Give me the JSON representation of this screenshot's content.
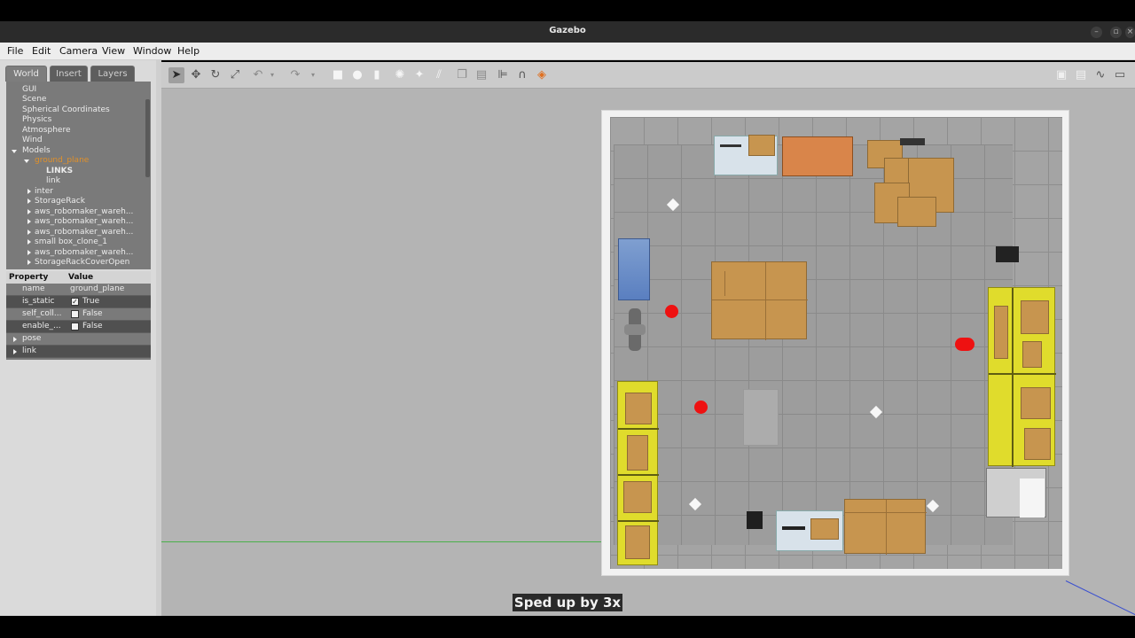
{
  "window": {
    "title": "Gazebo"
  },
  "menu": [
    "File",
    "Edit",
    "Camera",
    "View",
    "Window",
    "Help"
  ],
  "panel": {
    "tabs": [
      "World",
      "Insert",
      "Layers"
    ],
    "tree": {
      "gui": "GUI",
      "scene": "Scene",
      "spherical": "Spherical Coordinates",
      "physics": "Physics",
      "atmosphere": "Atmosphere",
      "wind": "Wind",
      "models": "Models",
      "selected": "ground_plane",
      "links": "LINKS",
      "link": "link",
      "items": [
        "inter",
        "StorageRack",
        "aws_robomaker_wareh...",
        "aws_robomaker_wareh...",
        "aws_robomaker_wareh...",
        "small box_clone_1",
        "aws_robomaker_wareh...",
        "StorageRackCoverOpen"
      ]
    },
    "props": {
      "col_property": "Property",
      "col_value": "Value",
      "name_key": "name",
      "name_val": "ground_plane",
      "static_key": "is_static",
      "static_val": "True",
      "selfcoll_key": "self_coll...",
      "selfcoll_val": "False",
      "enable_key": "enable_...",
      "enable_val": "False",
      "pose": "pose",
      "link": "link"
    }
  },
  "caption": "Sped up by 3x"
}
